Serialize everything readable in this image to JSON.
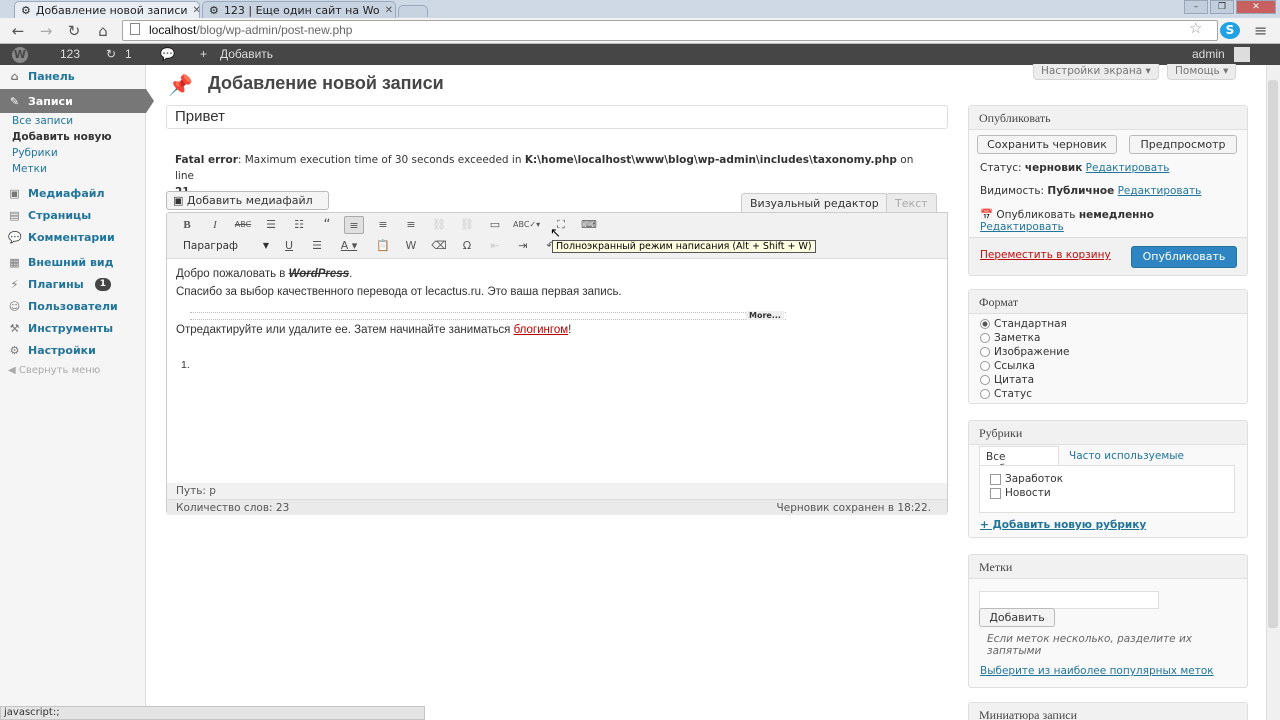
{
  "browser": {
    "tabs": [
      {
        "title": "Добавление новой записи",
        "active": true
      },
      {
        "title": "123 | Еще один сайт на Wo",
        "active": false
      }
    ],
    "url_host": "localhost",
    "url_path": "/blog/wp-admin/post-new.php",
    "status_text": "javascript:;"
  },
  "adminbar": {
    "site_name": "123",
    "updates_count": "1",
    "add_new": "Добавить",
    "user": "admin"
  },
  "sidebar": {
    "items": [
      {
        "label": "Панель",
        "icon": "dashboard-icon"
      },
      {
        "label": "Записи",
        "icon": "pin-icon"
      },
      {
        "label": "Медиафайл",
        "icon": "media-icon"
      },
      {
        "label": "Страницы",
        "icon": "pages-icon"
      },
      {
        "label": "Комментарии",
        "icon": "comments-icon"
      },
      {
        "label": "Внешний вид",
        "icon": "appearance-icon"
      },
      {
        "label": "Плагины",
        "icon": "plugins-icon",
        "badge": "1"
      },
      {
        "label": "Пользователи",
        "icon": "users-icon"
      },
      {
        "label": "Инструменты",
        "icon": "tools-icon"
      },
      {
        "label": "Настройки",
        "icon": "settings-icon"
      }
    ],
    "submenu": [
      "Все записи",
      "Добавить новую",
      "Рубрики",
      "Метки"
    ],
    "collapse": "Свернуть меню"
  },
  "header": {
    "title": "Добавление новой записи",
    "screen_options": "Настройки экрана",
    "help": "Помощь"
  },
  "post": {
    "title": "Привет",
    "fatal_label": "Fatal error",
    "fatal_msg": ": Maximum execution time of 30 seconds exceeded in ",
    "fatal_path": "K:\\home\\localhost\\www\\blog\\wp-admin\\includes\\taxonomy.php",
    "fatal_online": " on line ",
    "fatal_line": "21",
    "add_media": "Добавить медиафайл",
    "tab_visual": "Визуальный редактор",
    "tab_text": "Текст",
    "format_select": "Параграф",
    "tooltip": "Полноэкранный режим написания (Alt + Shift + W)",
    "line1_prefix": "Добро пожаловать в ",
    "line1_brand": "WordPress",
    "line1_suffix": ".",
    "line2": "Спасибо за выбор качественного перевода от lecactus.ru. Это ваша первая запись.",
    "more_label": "More...",
    "line3_prefix": "Отредактируйте или удалите ее. Затем начинайте заниматься ",
    "line3_link": "блогингом",
    "line3_suffix": "!",
    "list_item": "1.",
    "path": "Путь: p",
    "word_count": "Количество слов: 23",
    "draft_saved": "Черновик сохранен в 18:22."
  },
  "publish": {
    "title": "Опубликовать",
    "save_draft": "Сохранить черновик",
    "preview": "Предпросмотр",
    "status_label": "Статус: ",
    "status_value": "черновик",
    "visibility_label": "Видимость: ",
    "visibility_value": "Публичное",
    "edit": "Редактировать",
    "publish_label": "Опубликовать ",
    "publish_value": "немедленно",
    "trash": "Переместить в корзину",
    "publish_button": "Опубликовать"
  },
  "format": {
    "title": "Формат",
    "options": [
      "Стандартная",
      "Заметка",
      "Изображение",
      "Ссылка",
      "Цитата",
      "Статус"
    ],
    "selected": 0
  },
  "categories": {
    "title": "Рубрики",
    "tab_all": "Все рубрики",
    "tab_popular": "Часто используемые",
    "items": [
      "Заработок",
      "Новости"
    ],
    "add_new": "+ Добавить новую рубрику"
  },
  "tags": {
    "title": "Метки",
    "add_button": "Добавить",
    "hint": "Если меток несколько, разделите их запятыми",
    "popular_link": "Выберите из наиболее популярных меток"
  },
  "thumbnail": {
    "title": "Миниатюра записи"
  },
  "colors": {
    "adminbar": "#464646",
    "link": "#21759b",
    "publish_button": "#2e85c1",
    "trash": "#bc0b0b"
  }
}
